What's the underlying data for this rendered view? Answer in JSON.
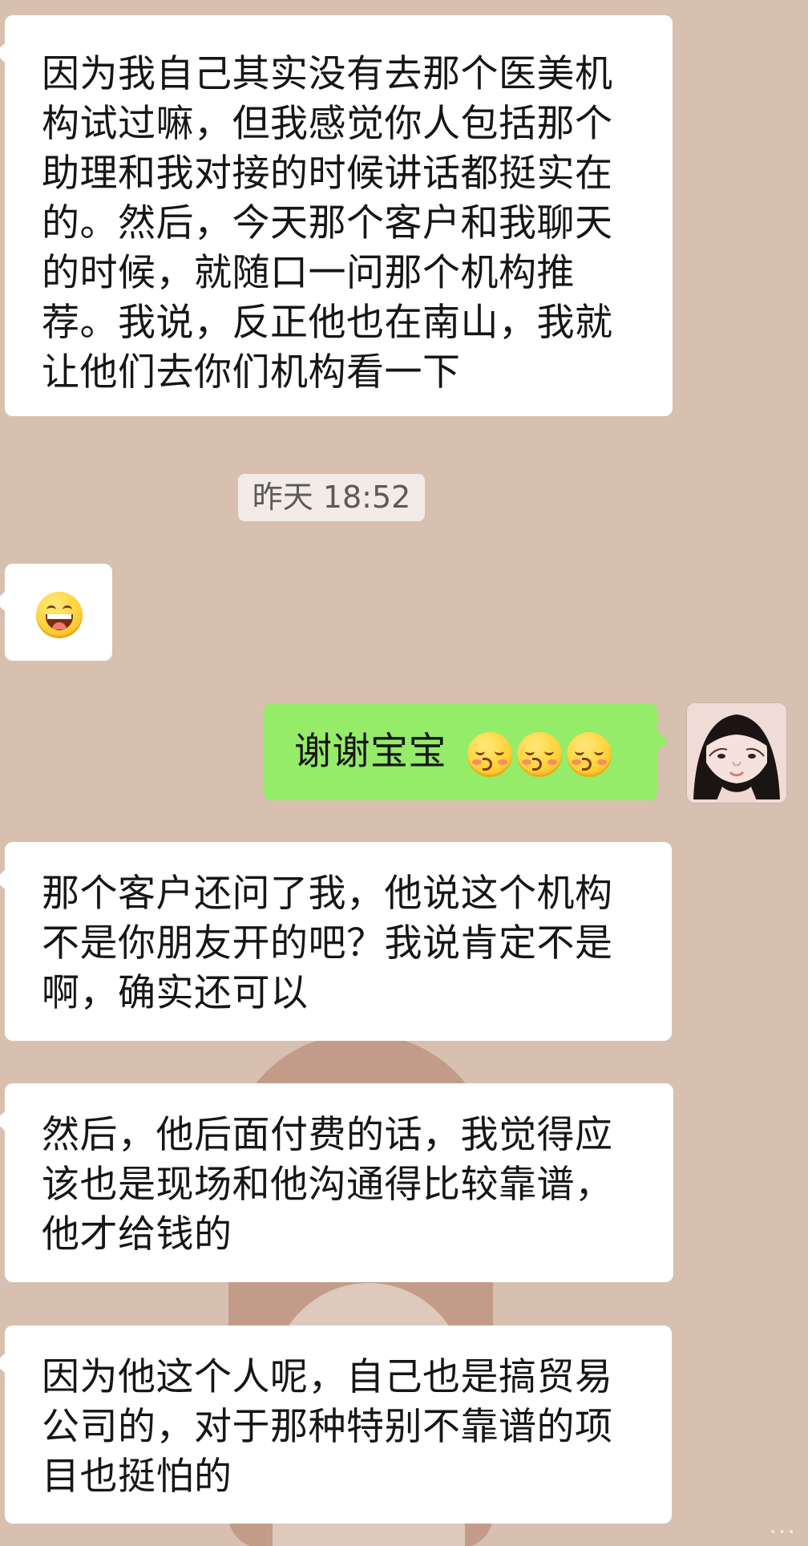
{
  "conversation": {
    "messages": [
      {
        "text": "因为我自己其实没有去那个医美机构试过嘛，但我感觉你人包括那个助理和我对接的时候讲话都挺实在的。然后，今天那个客户和我聊天的时候，就随口一问那个机构推荐。我说，反正他也在南山，我就让他们去你们机构看一下"
      },
      {
        "timestamp": "昨天 18:52"
      },
      {
        "emoji": "laughing-face"
      },
      {
        "text": "谢谢宝宝",
        "emoji": [
          "kissing-face",
          "kissing-face",
          "kissing-face"
        ]
      },
      {
        "text": "那个客户还问了我，他说这个机构不是你朋友开的吧？我说肯定不是啊，确实还可以"
      },
      {
        "text": "然后，他后面付费的话，我觉得应该也是现场和他沟通得比较靠谱，他才给钱的"
      },
      {
        "text": "因为他这个人呢，自己也是搞贸易公司的，对于那种特别不靠谱的项目也挺怕的"
      }
    ]
  },
  "colors": {
    "background": "#d8c0b1",
    "incoming_bubble": "#ffffff",
    "outgoing_bubble": "#95ec69",
    "timestamp_chip": "#f3ebe6"
  },
  "watermark": "..."
}
